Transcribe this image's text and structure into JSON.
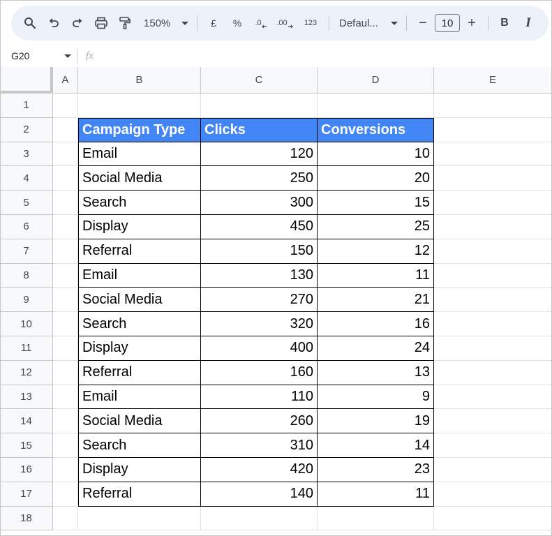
{
  "toolbar": {
    "zoom": "150%",
    "font": "Defaul...",
    "font_size": "10",
    "currency": "£",
    "percent": "%",
    "dec_decrease": ".0",
    "dec_increase": ".00",
    "more_formats": "123",
    "bold": "B",
    "italic": "I",
    "minus": "−",
    "plus": "+"
  },
  "formula_bar": {
    "name_box": "G20",
    "fx": "fx"
  },
  "columns": [
    "A",
    "B",
    "C",
    "D",
    "E"
  ],
  "row_numbers": [
    "1",
    "2",
    "3",
    "4",
    "5",
    "6",
    "7",
    "8",
    "9",
    "10",
    "11",
    "12",
    "13",
    "14",
    "15",
    "16",
    "17",
    "18"
  ],
  "table": {
    "headers": [
      "Campaign Type",
      "Clicks",
      "Conversions"
    ],
    "rows": [
      [
        "Email",
        "120",
        "10"
      ],
      [
        "Social Media",
        "250",
        "20"
      ],
      [
        "Search",
        "300",
        "15"
      ],
      [
        "Display",
        "450",
        "25"
      ],
      [
        "Referral",
        "150",
        "12"
      ],
      [
        "Email",
        "130",
        "11"
      ],
      [
        "Social Media",
        "270",
        "21"
      ],
      [
        "Search",
        "320",
        "16"
      ],
      [
        "Display",
        "400",
        "24"
      ],
      [
        "Referral",
        "160",
        "13"
      ],
      [
        "Email",
        "110",
        "9"
      ],
      [
        "Social Media",
        "260",
        "19"
      ],
      [
        "Search",
        "310",
        "14"
      ],
      [
        "Display",
        "420",
        "23"
      ],
      [
        "Referral",
        "140",
        "11"
      ]
    ]
  },
  "colors": {
    "header_fill": "#4285f4",
    "header_text": "#ffffff",
    "toolbar_bg": "#edf2fa"
  }
}
